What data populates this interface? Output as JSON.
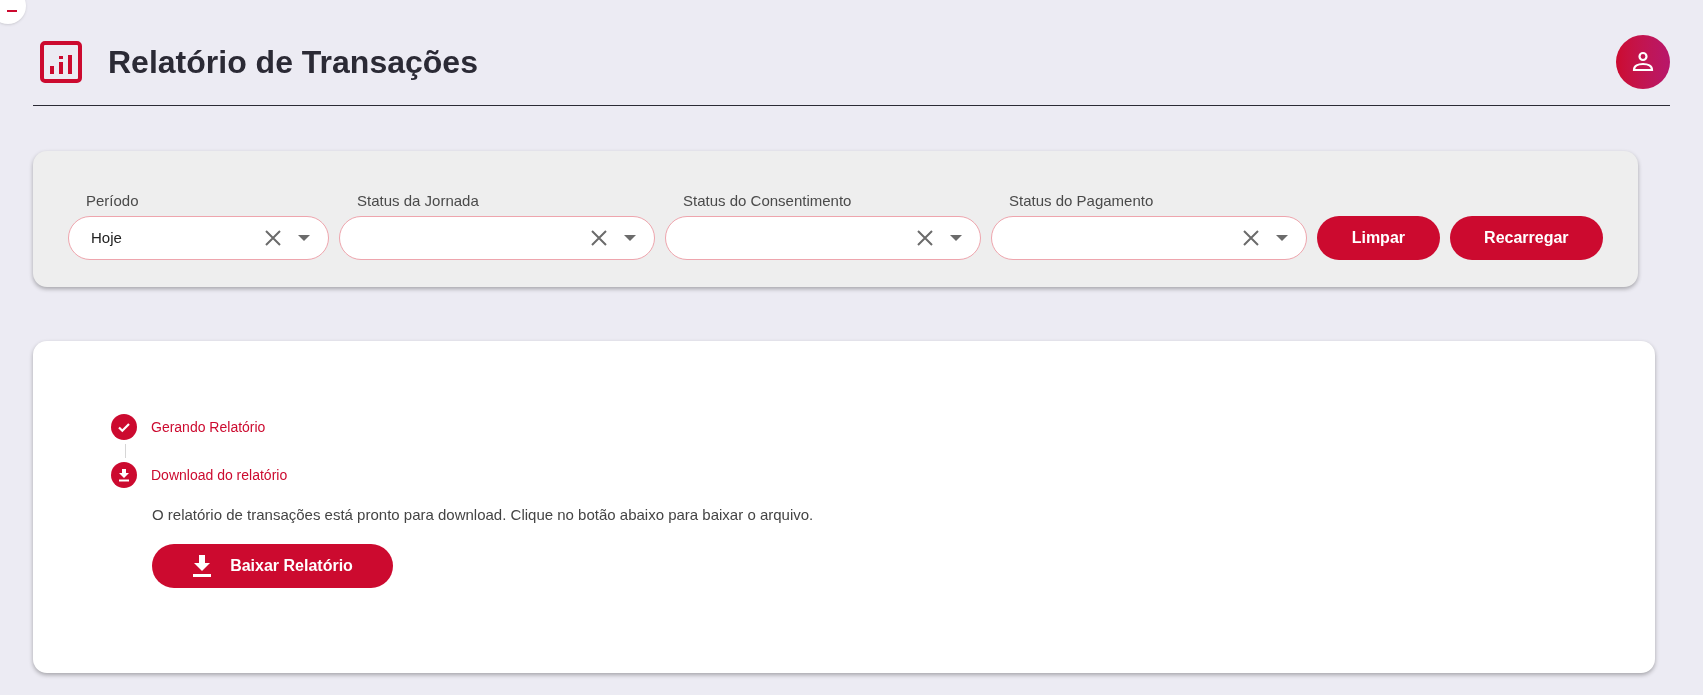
{
  "header": {
    "title": "Relatório de Transações"
  },
  "filters": [
    {
      "label": "Período",
      "value": "Hoje"
    },
    {
      "label": "Status da Jornada"
    },
    {
      "label": "Status do Consentimento"
    },
    {
      "label": "Status do Pagamento"
    }
  ],
  "buttons": [
    "Limpar",
    "Recarregar"
  ],
  "steps": [
    {
      "kind": "done",
      "label": "Gerando Relatório"
    },
    {
      "kind": "download",
      "label": "Download do relatório"
    }
  ],
  "message": "O relatório de transações está pronto para download. Clique no botão abaixo para baixar o arquivo.",
  "download_button": "Baixar Relatório"
}
